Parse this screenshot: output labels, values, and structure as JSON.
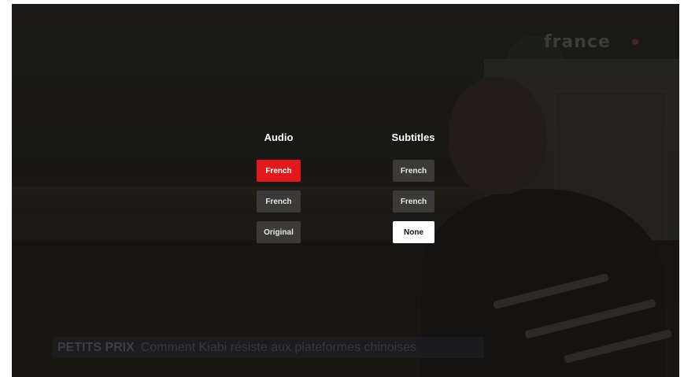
{
  "background": {
    "channel_logo": "france",
    "lower_third": {
      "tag": "PETITS PRIX",
      "headline": "Comment Kiabi résiste aux plateformes chinoises"
    }
  },
  "menu": {
    "audio": {
      "title": "Audio",
      "options": [
        {
          "label": "French",
          "state": "selected"
        },
        {
          "label": "French",
          "state": "default"
        },
        {
          "label": "Original",
          "state": "default"
        }
      ]
    },
    "subtitles": {
      "title": "Subtitles",
      "options": [
        {
          "label": "French",
          "state": "default"
        },
        {
          "label": "French",
          "state": "default"
        },
        {
          "label": "None",
          "state": "focused"
        }
      ]
    }
  },
  "colors": {
    "selected": "#e1191d",
    "focused": "#ffffff",
    "default": "#3b3a38"
  }
}
